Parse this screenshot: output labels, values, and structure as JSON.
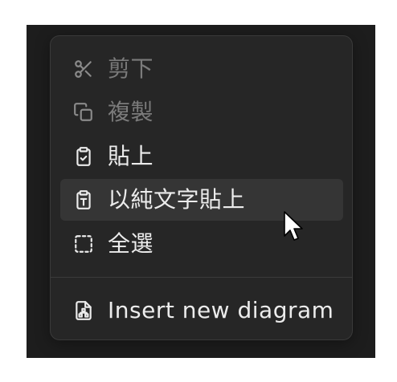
{
  "menu": {
    "items": [
      {
        "label": "剪下",
        "icon": "scissors-icon",
        "enabled": false
      },
      {
        "label": "複製",
        "icon": "copy-icon",
        "enabled": false
      },
      {
        "label": "貼上",
        "icon": "clipboard-check-icon",
        "enabled": true
      },
      {
        "label": "以純文字貼上",
        "icon": "clipboard-text-icon",
        "enabled": true,
        "hovered": true
      },
      {
        "label": "全選",
        "icon": "select-all-icon",
        "enabled": true
      }
    ],
    "extra_items": [
      {
        "label": "Insert new diagram",
        "icon": "diagram-file-icon",
        "enabled": true
      }
    ]
  },
  "colors": {
    "backdrop": "#1d1d1d",
    "menu_bg": "#262626",
    "hover_bg": "#353535",
    "text_enabled": "#ececec",
    "text_disabled": "#7b7b7b"
  }
}
